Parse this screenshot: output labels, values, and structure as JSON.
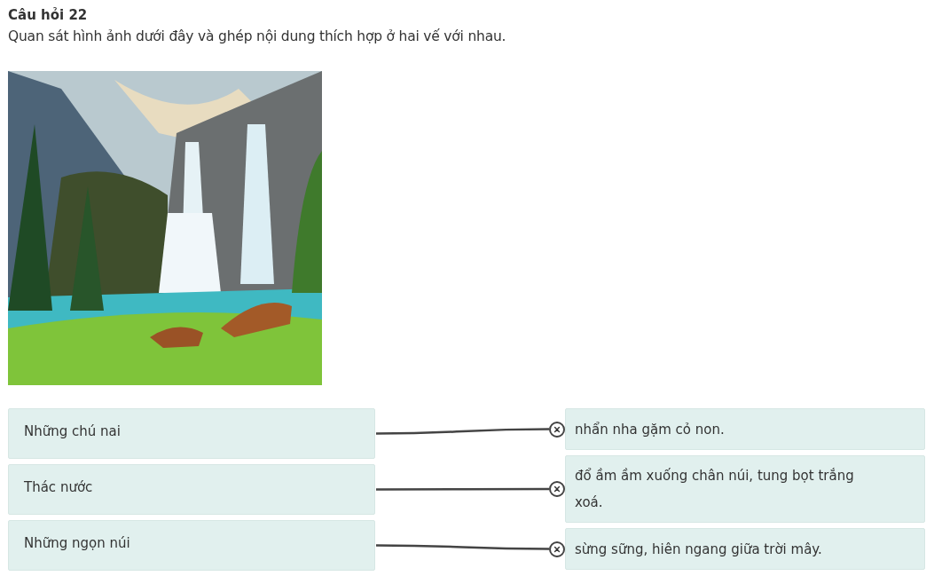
{
  "question": {
    "title": "Câu hỏi 22",
    "prompt": "Quan sát hình ảnh dưới đây và ghép nội dung thích hợp ở hai vế với nhau."
  },
  "left_items": [
    {
      "text": "Những chú nai",
      "linked": true
    },
    {
      "text": "Thác nước",
      "linked": true
    },
    {
      "text": "Những ngọn núi",
      "linked": true
    }
  ],
  "right_items": [
    {
      "text": "nhẩn nha gặm cỏ non."
    },
    {
      "text": "đổ ầm ầm xuống chân núi, tung bọt trắng xoá."
    },
    {
      "text": "sừng sững, hiên ngang giữa trời mây."
    }
  ]
}
